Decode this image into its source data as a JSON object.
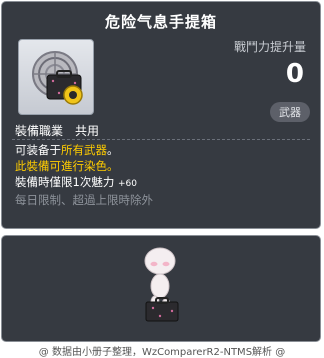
{
  "item_id": "01703571",
  "title": "危险气息手提箱",
  "power": {
    "label": "戰鬥力提升量",
    "value": "0"
  },
  "category_badge": "武器",
  "job": {
    "label": "裝備職業",
    "value": "共用"
  },
  "description": {
    "line1_prefix": "可装备于",
    "line1_highlight": "所有武器",
    "line1_suffix": "。",
    "line2": "此裝備可進行染色。",
    "line3_label": "裝備時僅限1次魅力",
    "line3_value": "+60",
    "line4": "每日限制、超過上限時除外"
  },
  "footer": "@ 数据由小册子整理，WzComparerR2-NTMS解析 @",
  "icon": "briefcase-icon",
  "colors": {
    "panel_bg": "#363a41",
    "highlight": "#ffcc00",
    "muted": "#8e939b"
  }
}
